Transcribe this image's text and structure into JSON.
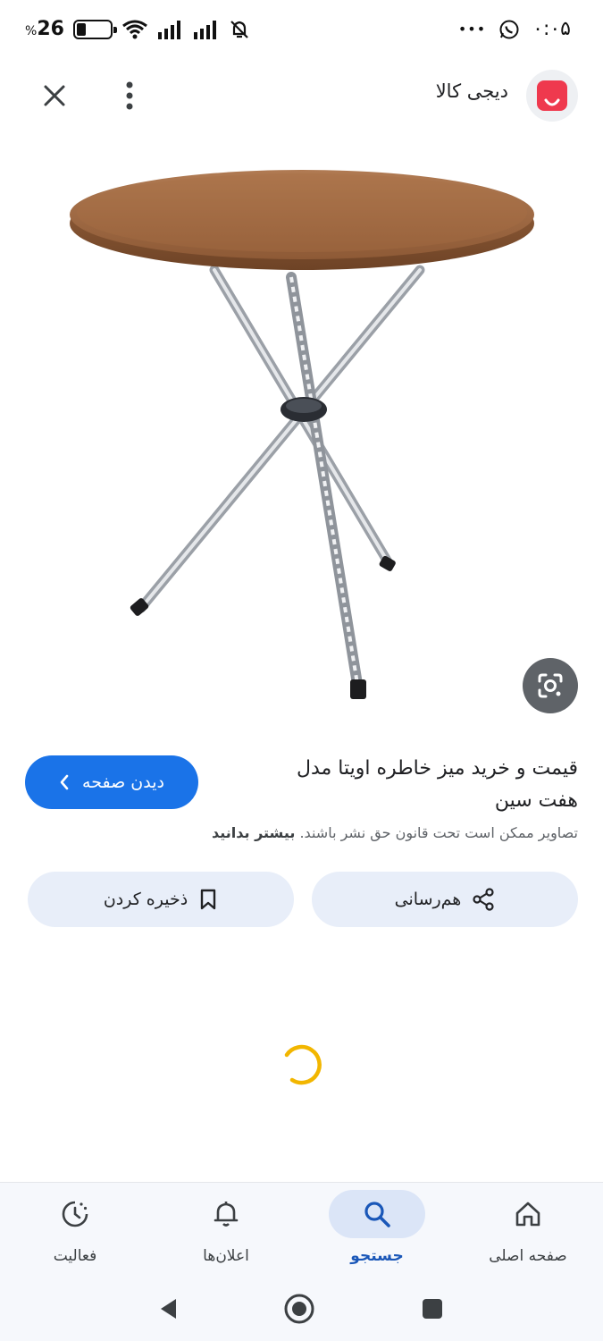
{
  "status_bar": {
    "battery_text": "26",
    "battery_level": 0.26,
    "time": "۰:۰۵",
    "more_dots": "•••"
  },
  "header": {
    "source_name": "دیجی کالا"
  },
  "result": {
    "title": "قیمت و خرید میز خاطره اویتا مدل هفت سین",
    "visit_label": "دیدن صفحه",
    "copyright_text": "تصاویر ممکن است تحت قانون حق نشر باشند.",
    "learn_more": "بیشتر بدانید"
  },
  "actions": {
    "share_label": "هم‌رسانی",
    "save_label": "ذخیره کردن"
  },
  "bottom_nav": {
    "items": [
      {
        "label": "صفحه اصلی",
        "icon": "home-icon"
      },
      {
        "label": "جستجو",
        "icon": "search-icon"
      },
      {
        "label": "اعلان‌ها",
        "icon": "bell-icon"
      },
      {
        "label": "فعالیت",
        "icon": "activity-icon"
      }
    ],
    "active": "جستجو"
  },
  "colors": {
    "accent": "#1a73e8",
    "brand": "#ef394e",
    "chip_bg": "#e8eef9"
  }
}
